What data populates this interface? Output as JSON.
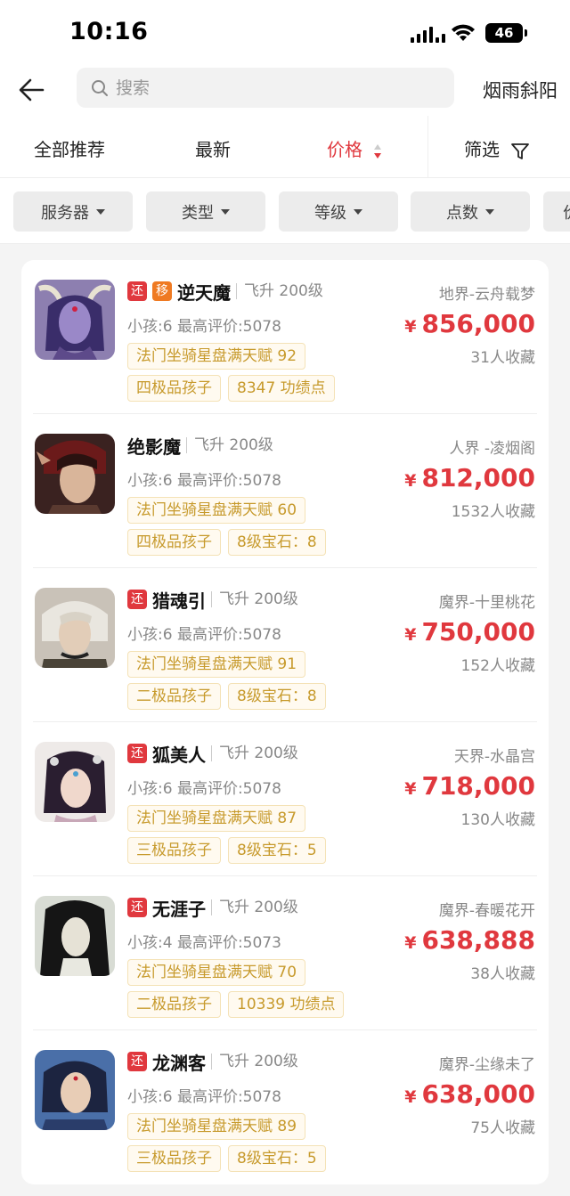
{
  "status_bar": {
    "time": "10:16",
    "battery": "46"
  },
  "search": {
    "placeholder": "搜索",
    "right_label": "烟雨斜阳"
  },
  "sort_tabs": {
    "recommend": "全部推荐",
    "newest": "最新",
    "price": "价格",
    "filter": "筛选"
  },
  "chips": [
    "服务器",
    "类型",
    "等级",
    "点数",
    "价"
  ],
  "colors": {
    "accent": "#e0383e",
    "tag_text": "#c79a2c",
    "badge_orange": "#ef7a22"
  },
  "items": [
    {
      "badges": [
        "还",
        "移"
      ],
      "name": "逆天魔",
      "level": "飞升 200级",
      "meta": "小孩:6 最高评价:5078",
      "tag1": "法门坐骑星盘满天赋 92",
      "tag2": "四极品孩子",
      "tag3": "8347 功绩点",
      "server": "地界-云舟载梦",
      "price": "856,000",
      "fav": "31人收藏"
    },
    {
      "badges": [],
      "name": "绝影魔",
      "level": "飞升 200级",
      "meta": "小孩:6 最高评价:5078",
      "tag1": "法门坐骑星盘满天赋 60",
      "tag2": "四极品孩子",
      "tag3": "8级宝石：8",
      "server": "人界 -凌烟阁",
      "price": "812,000",
      "fav": "1532人收藏"
    },
    {
      "badges": [
        "还"
      ],
      "name": "猎魂引",
      "level": "飞升 200级",
      "meta": "小孩:6 最高评价:5078",
      "tag1": "法门坐骑星盘满天赋 91",
      "tag2": "二极品孩子",
      "tag3": "8级宝石：8",
      "server": "魔界-十里桃花",
      "price": "750,000",
      "fav": "152人收藏"
    },
    {
      "badges": [
        "还"
      ],
      "name": "狐美人",
      "level": "飞升 200级",
      "meta": "小孩:6 最高评价:5078",
      "tag1": "法门坐骑星盘满天赋 87",
      "tag2": "三极品孩子",
      "tag3": "8级宝石：5",
      "server": "天界-水晶宫",
      "price": "718,000",
      "fav": "130人收藏"
    },
    {
      "badges": [
        "还"
      ],
      "name": "无涯子",
      "level": "飞升 200级",
      "meta": "小孩:4 最高评价:5073",
      "tag1": "法门坐骑星盘满天赋 70",
      "tag2": "二极品孩子",
      "tag3": "10339 功绩点",
      "server": "魔界-春暖花开",
      "price": "638,888",
      "fav": "38人收藏"
    },
    {
      "badges": [
        "还"
      ],
      "name": "龙渊客",
      "level": "飞升 200级",
      "meta": "小孩:6 最高评价:5078",
      "tag1": "法门坐骑星盘满天赋 89",
      "tag2": "三极品孩子",
      "tag3": "8级宝石：5",
      "server": "魔界-尘缘未了",
      "price": "638,000",
      "fav": "75人收藏"
    }
  ]
}
